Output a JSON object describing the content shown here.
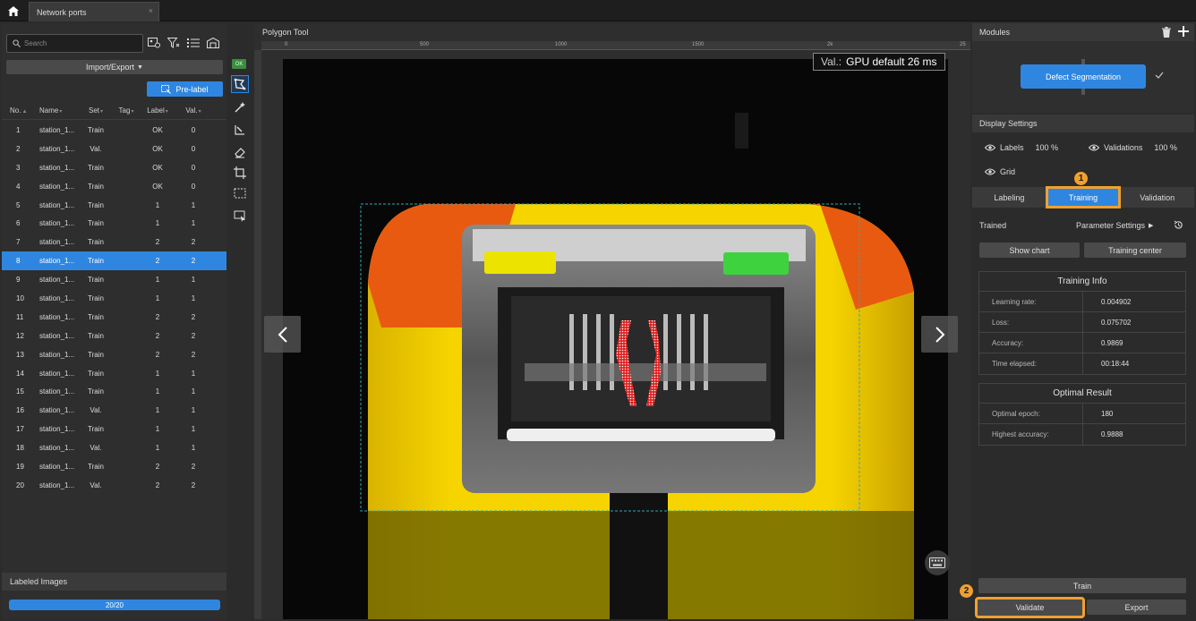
{
  "tab": {
    "title": "Network ports",
    "close": "×"
  },
  "left": {
    "search_placeholder": "Search",
    "import_export": "Import/Export",
    "prelabel": "Pre-label",
    "columns": [
      "No.",
      "Name",
      "Set",
      "Tag",
      "Label",
      "Val."
    ],
    "rows": [
      {
        "no": "1",
        "name": "station_1...",
        "set": "Train",
        "tag": "",
        "label": "OK",
        "val": "0"
      },
      {
        "no": "2",
        "name": "station_1...",
        "set": "Val.",
        "tag": "",
        "label": "OK",
        "val": "0"
      },
      {
        "no": "3",
        "name": "station_1...",
        "set": "Train",
        "tag": "",
        "label": "OK",
        "val": "0"
      },
      {
        "no": "4",
        "name": "station_1...",
        "set": "Train",
        "tag": "",
        "label": "OK",
        "val": "0"
      },
      {
        "no": "5",
        "name": "station_1...",
        "set": "Train",
        "tag": "",
        "label": "1",
        "val": "1"
      },
      {
        "no": "6",
        "name": "station_1...",
        "set": "Train",
        "tag": "",
        "label": "1",
        "val": "1"
      },
      {
        "no": "7",
        "name": "station_1...",
        "set": "Train",
        "tag": "",
        "label": "2",
        "val": "2"
      },
      {
        "no": "8",
        "name": "station_1...",
        "set": "Train",
        "tag": "",
        "label": "2",
        "val": "2",
        "selected": true
      },
      {
        "no": "9",
        "name": "station_1...",
        "set": "Train",
        "tag": "",
        "label": "1",
        "val": "1"
      },
      {
        "no": "10",
        "name": "station_1...",
        "set": "Train",
        "tag": "",
        "label": "1",
        "val": "1"
      },
      {
        "no": "11",
        "name": "station_1...",
        "set": "Train",
        "tag": "",
        "label": "2",
        "val": "2"
      },
      {
        "no": "12",
        "name": "station_1...",
        "set": "Train",
        "tag": "",
        "label": "2",
        "val": "2"
      },
      {
        "no": "13",
        "name": "station_1...",
        "set": "Train",
        "tag": "",
        "label": "2",
        "val": "2"
      },
      {
        "no": "14",
        "name": "station_1...",
        "set": "Train",
        "tag": "",
        "label": "1",
        "val": "1"
      },
      {
        "no": "15",
        "name": "station_1...",
        "set": "Train",
        "tag": "",
        "label": "1",
        "val": "1"
      },
      {
        "no": "16",
        "name": "station_1...",
        "set": "Val.",
        "tag": "",
        "label": "1",
        "val": "1"
      },
      {
        "no": "17",
        "name": "station_1...",
        "set": "Train",
        "tag": "",
        "label": "1",
        "val": "1"
      },
      {
        "no": "18",
        "name": "station_1...",
        "set": "Val.",
        "tag": "",
        "label": "1",
        "val": "1"
      },
      {
        "no": "19",
        "name": "station_1...",
        "set": "Train",
        "tag": "",
        "label": "2",
        "val": "2"
      },
      {
        "no": "20",
        "name": "station_1...",
        "set": "Val.",
        "tag": "",
        "label": "2",
        "val": "2"
      }
    ],
    "labeled_images": "Labeled Images",
    "progress_text": "20/20",
    "progress_fraction": 1.0
  },
  "toolstrip": {
    "ok": "OK"
  },
  "center": {
    "title": "Polygon Tool",
    "ruler_ticks": [
      "0",
      "500",
      "1000",
      "1500",
      "2k",
      "25"
    ],
    "val_key": "Val.:",
    "val_text": "GPU default 26 ms"
  },
  "right": {
    "modules": "Modules",
    "module_name": "Defect Segmentation",
    "display_settings": "Display Settings",
    "labels": "Labels",
    "labels_pct": "100 %",
    "validations": "Validations",
    "validations_pct": "100 %",
    "grid": "Grid",
    "tabs": [
      "Labeling",
      "Training",
      "Validation"
    ],
    "trained": "Trained",
    "param_settings": "Parameter Settings",
    "show_chart": "Show chart",
    "training_center": "Training center",
    "training_info": {
      "title": "Training Info",
      "rows": [
        {
          "k": "Learning rate:",
          "v": "0.004902"
        },
        {
          "k": "Loss:",
          "v": "0.075702"
        },
        {
          "k": "Accuracy:",
          "v": "0.9869"
        },
        {
          "k": "Time elapsed:",
          "v": "00:18:44"
        }
      ]
    },
    "optimal_result": {
      "title": "Optimal Result",
      "rows": [
        {
          "k": "Optimal epoch:",
          "v": "180"
        },
        {
          "k": "Highest accuracy:",
          "v": "0.9888"
        }
      ]
    },
    "train": "Train",
    "validate": "Validate",
    "export": "Export",
    "step1": "1",
    "step2": "2"
  },
  "colors": {
    "accent": "#2f86e0",
    "highlight": "#f0a030",
    "panel": "#2e2e2e"
  },
  "icons": [
    "home-icon",
    "search-icon",
    "image-filter-icon",
    "filter-icon",
    "list-icon",
    "folder-icon",
    "polygon-icon",
    "magic-wand-icon",
    "brush-icon",
    "eraser-icon",
    "crop-icon",
    "rectangle-select-icon",
    "ai-select-icon",
    "trash-icon",
    "plus-icon",
    "eye-icon",
    "history-icon",
    "keyboard-icon",
    "chevron-left-icon",
    "chevron-right-icon",
    "check-icon"
  ]
}
